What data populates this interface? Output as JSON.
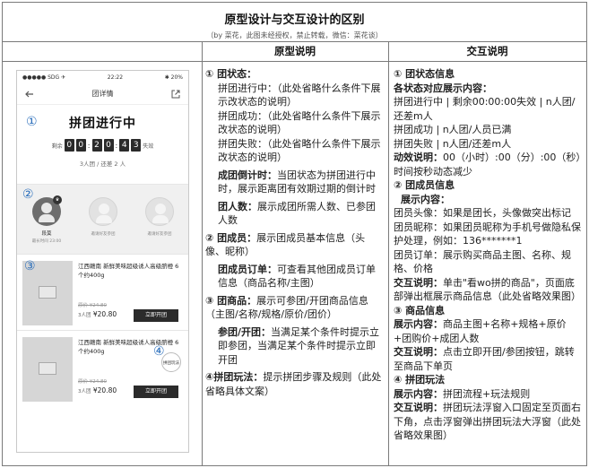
{
  "title": "原型设计与交互设计的区别",
  "subtitle": "（by 菜花，此图未经授权，禁止转载，微信：菜花谈）",
  "headers": {
    "prototype": "原型说明",
    "interaction": "交互说明"
  },
  "phone": {
    "status_left": "●●●●● SDG ✈",
    "status_time": "22:22",
    "status_right": "✱ 20%",
    "nav_title": "团详情",
    "group_status": "拼团进行中",
    "countdown_prefix": "剩余",
    "countdown_digits": [
      "0",
      "0",
      "2",
      "0",
      "4",
      "3"
    ],
    "countdown_suffix": "失效",
    "people": "3人团 / 还差 2 人",
    "leader_name": "段莫",
    "leader_sub": "最长时间 23:00",
    "empty_name_1": "邀请好友参团",
    "empty_name_2": "邀请好友参团",
    "product_1": {
      "name": "江西赣南 新鲜美味超级诱人高级脐橙 6个约400g",
      "old_price": "原价 ¥24.80",
      "group_label": "3人团",
      "price": "¥20.80",
      "button": "立即开团"
    },
    "product_2": {
      "name": "江西赣南 新鲜美味超级诱人高级脐橙 6个约400g",
      "old_price": "原价 ¥24.80",
      "group_label": "3人团",
      "price": "¥20.80",
      "button": "立即开团"
    },
    "float_button": "拼团玩法"
  },
  "prototype_notes": {
    "s1_title": "① 团状态：",
    "s1_l1": "拼团进行中：（此处省略什么条件下展示改状态的说明）",
    "s1_l2": "拼团成功：（此处省略什么条件下展示改状态的说明）",
    "s1_l3": "拼团失败：（此处省略什么条件下展示改状态的说明）",
    "countdown_label": "成团倒计时：",
    "countdown_text": "当团状态为拼团进行中时，展示距离团有效期过期的倒计时",
    "members_label": "团人数：",
    "members_text": "展示成团所需人数、已参团人数",
    "s2_title": "② 团成员：",
    "s2_text": "展示团成员基本信息（头像、昵称）",
    "order_label": "团成员订单：",
    "order_text": "可查看其他团成员订单信息（商品名称/主图）",
    "s3_title": "③ 团商品：",
    "s3_text": "展示可参团/开团商品信息（主图/名称/规格/原价/团价）",
    "join_label": "参团/开团：",
    "join_text": "当满足某个条件时提示立即参团，当满足某个条件时提示立即开团",
    "s4_title": "④拼团玩法：",
    "s4_text": "提示拼团步骤及规则（此处省略具体文案）"
  },
  "interaction_notes": {
    "s1_title": "① 团状态信息",
    "s1_sub": "各状态对应展示内容：",
    "s1_l1": "拼团进行中 | 剩余00:00:00失效 | n人团/还差m人",
    "s1_l2": "拼团成功 | n人团/人员已满",
    "s1_l3": "拼团失败 | n人团/还差m人",
    "anim_label": "动效说明：",
    "anim_text": "00（小时）:00（分）:00（秒）时间按秒动态减少",
    "s2_title": "② 团成员信息",
    "s2_sub": "展示内容：",
    "s2_l1": "团员头像：如果是团长，头像做突出标记",
    "s2_l2": "团员昵称：如果团员昵称为手机号做隐私保护处理，例如：136*******1",
    "s2_l3": "团员订单：展示购买商品主图、名称、规格、价格",
    "s2_inter_label": "交互说明：",
    "s2_inter_text": "单击\"看wo拼的商品\"，页面底部弹出框展示商品信息（此处省略效果图）",
    "s3_title": "③ 商品信息",
    "s3_show_label": "展示内容：",
    "s3_show_text": "商品主图+名称+规格+原价+团购价+成团人数",
    "s3_inter_label": "交互说明：",
    "s3_inter_text": "点击立即开团/参团按钮，跳转至商品下单页",
    "s4_title": "④ 拼团玩法",
    "s4_show_label": "展示内容：",
    "s4_show_text": "拼团流程+玩法规则",
    "s4_inter_label": "交互说明：",
    "s4_inter_text": "拼团玩法浮窗入口固定至页面右下角，点击浮窗弹出拼团玩法大浮窗（此处省略效果图）"
  }
}
